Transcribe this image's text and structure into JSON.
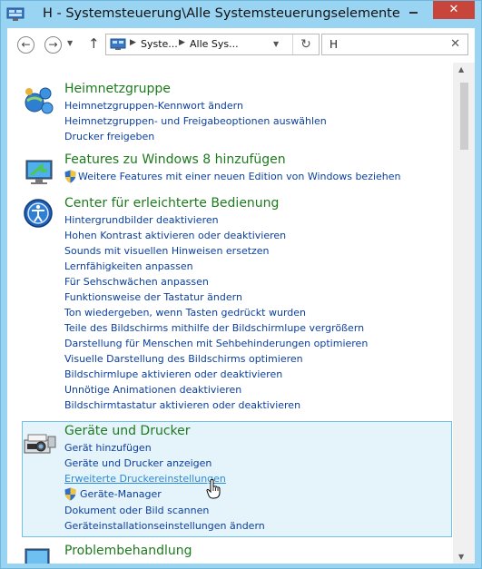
{
  "window": {
    "title": "H - Systemsteuerung\\Alle Systemsteuerungselemente",
    "close_label": "✕"
  },
  "nav": {
    "breadcrumb_1": "Syste...",
    "breadcrumb_2": "Alle Sys...",
    "search_value": "H",
    "search_clear": "✕"
  },
  "sections": [
    {
      "title": "Heimnetzgruppe",
      "links": [
        "Heimnetzgruppen-Kennwort ändern",
        "Heimnetzgruppen- und Freigabeoptionen auswählen",
        "Drucker freigeben"
      ]
    },
    {
      "title": "Features zu Windows 8 hinzufügen",
      "links": [
        "Weitere Features mit einer neuen Edition von Windows beziehen"
      ]
    },
    {
      "title": "Center für erleichterte Bedienung",
      "links": [
        "Hintergrundbilder deaktivieren",
        "Hohen Kontrast aktivieren oder deaktivieren",
        "Sounds mit visuellen Hinweisen ersetzen",
        "Lernfähigkeiten anpassen",
        "Für Sehschwächen anpassen",
        "Funktionsweise der Tastatur ändern",
        "Ton wiedergeben, wenn Tasten gedrückt wurden",
        "Teile des Bildschirms mithilfe der Bildschirmlupe vergrößern",
        "Darstellung für Menschen mit Sehbehinderungen optimieren",
        "Visuelle Darstellung des Bildschirms optimieren",
        "Bildschirmlupe aktivieren oder deaktivieren",
        "Unnötige Animationen deaktivieren",
        "Bildschirmtastatur aktivieren oder deaktivieren"
      ]
    },
    {
      "title": "Geräte und Drucker",
      "links": [
        "Gerät hinzufügen",
        "Geräte und Drucker anzeigen",
        "Erweiterte Druckereinstellungen",
        "Geräte-Manager",
        "Dokument oder Bild scannen",
        "Geräteinstallationseinstellungen ändern"
      ]
    },
    {
      "title": "Problembehandlung",
      "links": []
    }
  ],
  "colors": {
    "title_green": "#1e7a1e",
    "link_blue": "#0b3f9c",
    "hover_link": "#2a8ad4",
    "highlight_bg": "#e5f3fb",
    "frame": "#9ad4f3"
  }
}
